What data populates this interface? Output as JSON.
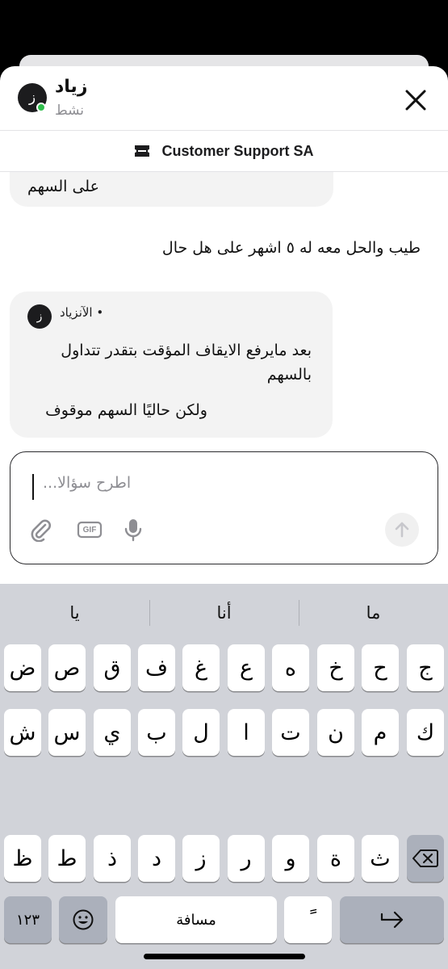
{
  "header": {
    "contact_name": "زياد",
    "contact_status": "نشط",
    "avatar_initial": "ز"
  },
  "channel": {
    "label": "Customer Support SA"
  },
  "messages": {
    "previous_fragment": "على السهم",
    "user_message": "طيب والحل معه له ٥ اشهر على هل حال",
    "agent": {
      "meta": "• الآنزياد",
      "avatar_initial": "ز",
      "line1": "بعد مايرفع الايقاف المؤقت بتقدر تتداول بالسهم",
      "line2": "ولكن حاليًا السهم موقوف"
    }
  },
  "composer": {
    "placeholder": "اطرح سؤالا...",
    "gif_label": "GIF"
  },
  "keyboard": {
    "suggestions": [
      "ما",
      "أنا",
      "يا"
    ],
    "row1": [
      "ج",
      "ح",
      "خ",
      "ه",
      "ع",
      "غ",
      "ف",
      "ق",
      "ص",
      "ض"
    ],
    "row2": [
      "ك",
      "م",
      "ن",
      "ت",
      "ا",
      "ل",
      "ب",
      "ي",
      "س",
      "ش"
    ],
    "row3": [
      "ث",
      "ة",
      "و",
      "ر",
      "ز",
      "د",
      "ذ",
      "ط",
      "ظ"
    ],
    "numbers_key": "١٢٣",
    "space_label": "مسافة",
    "diacritic_key": "ً"
  }
}
